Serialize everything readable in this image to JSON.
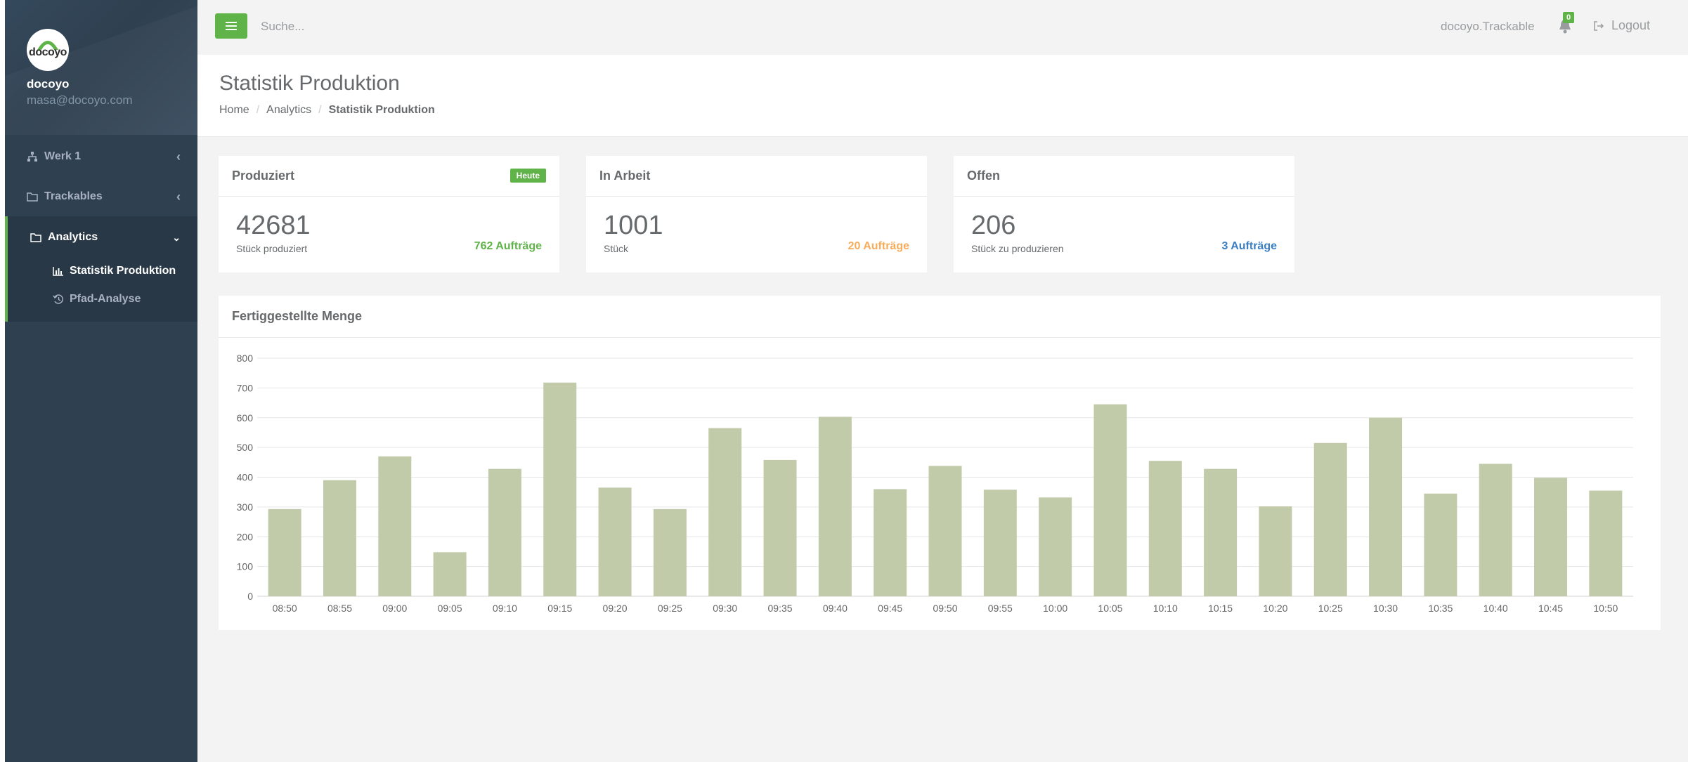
{
  "app": {
    "brand_logo_text": "docoyo",
    "profile_name": "docoyo",
    "profile_email": "masa@docoyo.com"
  },
  "sidebar": {
    "items": [
      {
        "label": "Werk 1",
        "icon": "sitemap-icon"
      },
      {
        "label": "Trackables",
        "icon": "folder-icon"
      },
      {
        "label": "Analytics",
        "icon": "folder-open-icon",
        "active": true
      }
    ],
    "sub_items": [
      {
        "label": "Statistik Produktion",
        "icon": "bar-chart-icon",
        "active": true
      },
      {
        "label": "Pfad-Analyse",
        "icon": "history-icon",
        "active": false
      }
    ]
  },
  "topbar": {
    "search_placeholder": "Suche...",
    "user": "docoyo.Trackable",
    "notification_count": "0",
    "logout_label": "Logout"
  },
  "page": {
    "title": "Statistik Produktion",
    "breadcrumb": [
      "Home",
      "Analytics",
      "Statistik Produktion"
    ]
  },
  "widgets": [
    {
      "title": "Produziert",
      "badge": "Heute",
      "value": "42681",
      "sub": "Stück produziert",
      "orders": "762 Aufträge",
      "orders_color": "#5fb348"
    },
    {
      "title": "In Arbeit",
      "value": "1001",
      "sub": "Stück",
      "orders": "20 Aufträge",
      "orders_color": "#f8ac59"
    },
    {
      "title": "Offen",
      "value": "206",
      "sub": "Stück zu produzieren",
      "orders": "3 Aufträge",
      "orders_color": "#3a7fc4"
    }
  ],
  "colors": {
    "accent": "#5fb348",
    "sidebar_bg": "#2f4050",
    "bar_fill": "#c2cba9"
  },
  "chart_data": {
    "type": "bar",
    "title": "Fertiggestellte Menge",
    "xlabel": "",
    "ylabel": "",
    "ylim": [
      0,
      800
    ],
    "yticks": [
      0,
      100,
      200,
      300,
      400,
      500,
      600,
      700,
      800
    ],
    "grid": true,
    "categories": [
      "08:50",
      "08:55",
      "09:00",
      "09:05",
      "09:10",
      "09:15",
      "09:20",
      "09:25",
      "09:30",
      "09:35",
      "09:40",
      "09:45",
      "09:50",
      "09:55",
      "10:00",
      "10:05",
      "10:10",
      "10:15",
      "10:20",
      "10:25",
      "10:30",
      "10:35",
      "10:40",
      "10:45",
      "10:50"
    ],
    "values": [
      293,
      390,
      470,
      148,
      428,
      718,
      365,
      293,
      565,
      458,
      603,
      360,
      438,
      358,
      332,
      645,
      455,
      428,
      302,
      515,
      600,
      345,
      445,
      398,
      355
    ]
  }
}
